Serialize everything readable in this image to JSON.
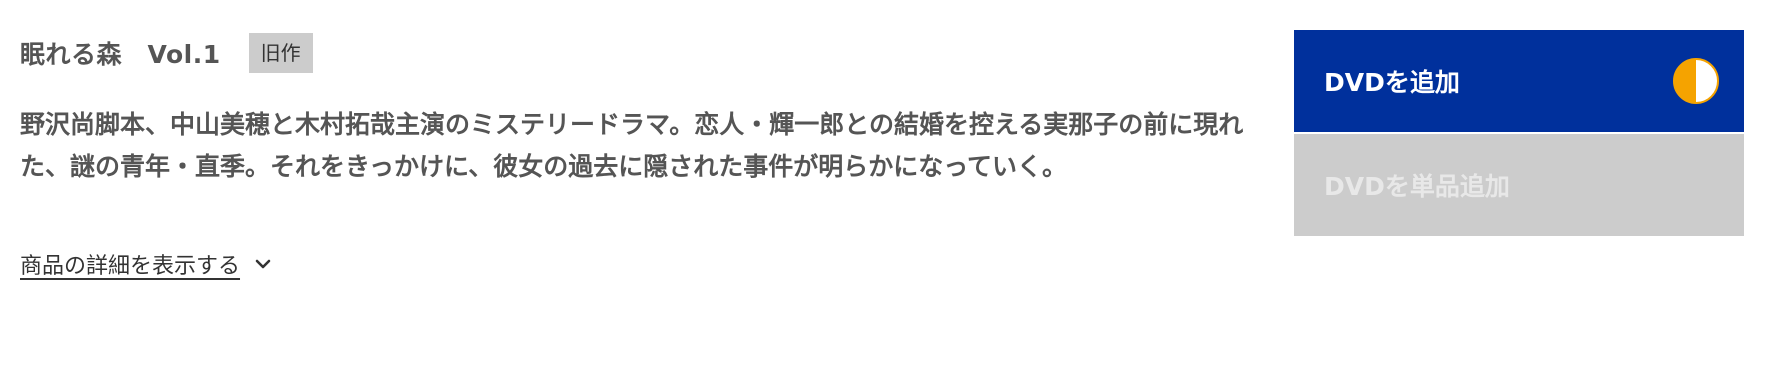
{
  "product": {
    "title": "眠れる森　Vol.1",
    "badge": "旧作",
    "description": "野沢尚脚本、中山美穂と木村拓哉主演のミステリードラマ。恋人・輝一郎との結婚を控える実那子の前に現れた、謎の青年・直季。それをきっかけに、彼女の過去に隠された事件が明らかになっていく。",
    "details_link": "商品の詳細を表示する"
  },
  "actions": {
    "add_dvd_label": "DVDを追加",
    "add_single_label": "DVDを単品追加"
  },
  "icons": {
    "half_circle": "half-circle-icon",
    "chevron": "chevron-down-icon"
  },
  "colors": {
    "primary_button": "#00309c",
    "disabled_button": "#cccccc",
    "icon_orange": "#f5a300",
    "text": "#555555",
    "badge": "#cccccc"
  }
}
